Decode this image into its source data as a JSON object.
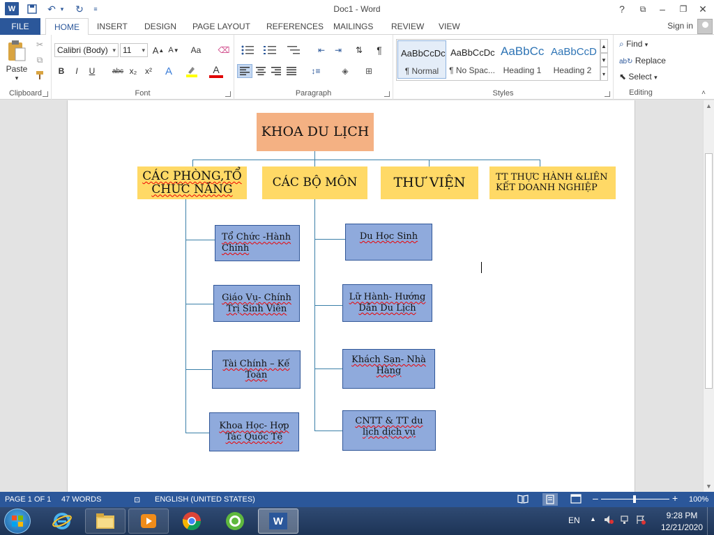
{
  "title_bar": {
    "document_title": "Doc1 - Word",
    "app_icon": "word-logo-icon",
    "word_logo_letter": "W",
    "quick_access": [
      "save-icon",
      "undo-icon",
      "redo-icon",
      "customize-qat-icon"
    ],
    "window_controls": [
      "help-icon",
      "ribbon-display-options-icon",
      "minimize-icon",
      "restore-icon",
      "close-icon"
    ]
  },
  "ribbon_tabs": {
    "file": "FILE",
    "tabs": [
      "HOME",
      "INSERT",
      "DESIGN",
      "PAGE LAYOUT",
      "REFERENCES",
      "MAILINGS",
      "REVIEW",
      "VIEW"
    ],
    "active": "HOME",
    "sign_in": "Sign in"
  },
  "ribbon": {
    "clipboard": {
      "label": "Clipboard",
      "paste": "Paste"
    },
    "font": {
      "label": "Font",
      "font_name": "Calibri (Body)",
      "font_size": "11",
      "change_case": "Aa",
      "bold": "B",
      "italic": "I",
      "underline": "U",
      "strikethrough": "abc",
      "subscript": "x₂",
      "superscript": "x²",
      "text_effects": "A",
      "font_color": "A"
    },
    "paragraph": {
      "label": "Paragraph",
      "pilcrow": "¶"
    },
    "styles": {
      "label": "Styles",
      "items": [
        {
          "sample": "AaBbCcDc",
          "name": "¶ Normal"
        },
        {
          "sample": "AaBbCcDc",
          "name": "¶ No Spac..."
        },
        {
          "sample": "AaBbCc",
          "name": "Heading 1"
        },
        {
          "sample": "AaBbCcD",
          "name": "Heading 2"
        }
      ]
    },
    "editing": {
      "label": "Editing",
      "find": "Find",
      "replace": "Replace",
      "select": "Select"
    }
  },
  "document": {
    "org_chart": {
      "root": "KHOA DU LỊCH",
      "level1": [
        "CÁC PHÒNG,TỔ CHỨC NĂNG",
        "CÁC BỘ MÔN",
        "THƯ VIỆN",
        "TT THỰC HÀNH &LIÊN KẾT DOANH NGHIỆP"
      ],
      "departments": [
        "Tổ Chức -Hành Chính",
        "Giáo Vụ- Chính Trị Sinh Viên",
        "Tài Chính – Kế Toán",
        "Khoa Học- Hợp Tác Quốc Tế"
      ],
      "subjects": [
        "Du Học Sinh",
        "Lữ Hành- Hướng Dẫn Du Lịch",
        "Khách Sạn- Nhà Hàng",
        "CNTT & TT du lịch dịch vụ"
      ]
    }
  },
  "status_bar": {
    "page": "PAGE 1 OF 1",
    "words": "47 WORDS",
    "language": "ENGLISH (UNITED STATES)",
    "zoom": "100%"
  },
  "taskbar": {
    "apps": [
      "internet-explorer-icon",
      "file-explorer-icon",
      "media-player-icon",
      "chrome-icon",
      "coccoc-icon",
      "word-icon"
    ],
    "word_label": "W",
    "language": "EN",
    "time": "9:28 PM",
    "date": "12/21/2020"
  },
  "colors": {
    "brand_blue": "#2b579a",
    "root_fill": "#f4b183",
    "level1_fill": "#ffd966",
    "level2_fill": "#8faadc",
    "connector": "#3a7fa8"
  }
}
